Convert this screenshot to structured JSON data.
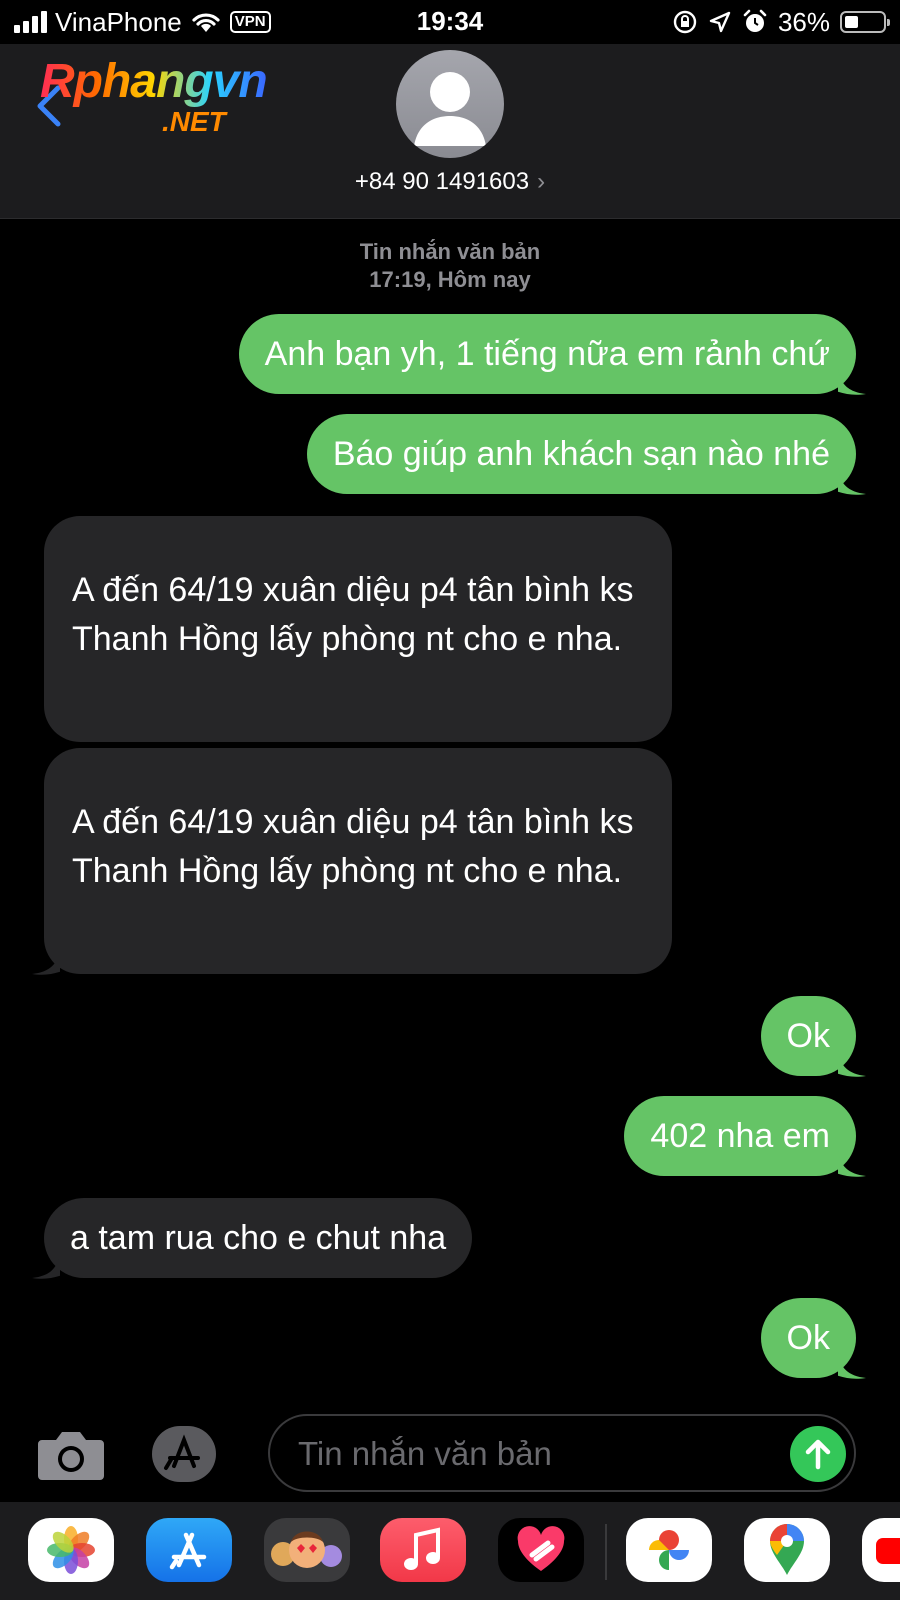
{
  "status_bar": {
    "carrier": "VinaPhone",
    "vpn": "VPN",
    "time": "19:34",
    "battery_text": "36%",
    "battery_level": 0.36
  },
  "header": {
    "logo_main": "Rphangvn",
    "logo_sub": ".NET",
    "contact_number": "+84 90 1491603",
    "contact_chevron": "›"
  },
  "thread": {
    "service": "Tin nhắn văn bản",
    "timestamp": "17:19, Hôm nay",
    "messages": [
      {
        "dir": "out",
        "text": "Anh bạn yh, 1 tiếng nữa em rảnh chứ"
      },
      {
        "dir": "out",
        "text": "Báo giúp anh khách sạn nào nhé"
      },
      {
        "dir": "in",
        "text": "A đến 64/19 xuân diệu p4 tân bình ks Thanh Hồng lấy phòng nt cho e nha."
      },
      {
        "dir": "in",
        "text": "A đến 64/19 xuân diệu p4 tân bình ks Thanh Hồng lấy phòng nt cho e nha."
      },
      {
        "dir": "out",
        "text": "Ok"
      },
      {
        "dir": "out",
        "text": "402 nha em"
      },
      {
        "dir": "in",
        "text": "a tam rua cho e chut nha"
      },
      {
        "dir": "out",
        "text": "Ok"
      }
    ]
  },
  "composer": {
    "placeholder": "Tin nhắn văn bản",
    "camera_icon": "camera-icon",
    "apps_icon": "app-store-icon",
    "send_icon": "arrow-up-icon"
  },
  "dock": {
    "apps": [
      "photos-icon",
      "app-store-icon",
      "memoji-icon",
      "music-icon",
      "fitness-heart-icon",
      "google-photos-icon",
      "google-maps-icon",
      "youtube-icon"
    ]
  },
  "colors": {
    "outgoing": "#65c466",
    "incoming": "#262628",
    "background": "#000000",
    "send": "#34c759"
  }
}
